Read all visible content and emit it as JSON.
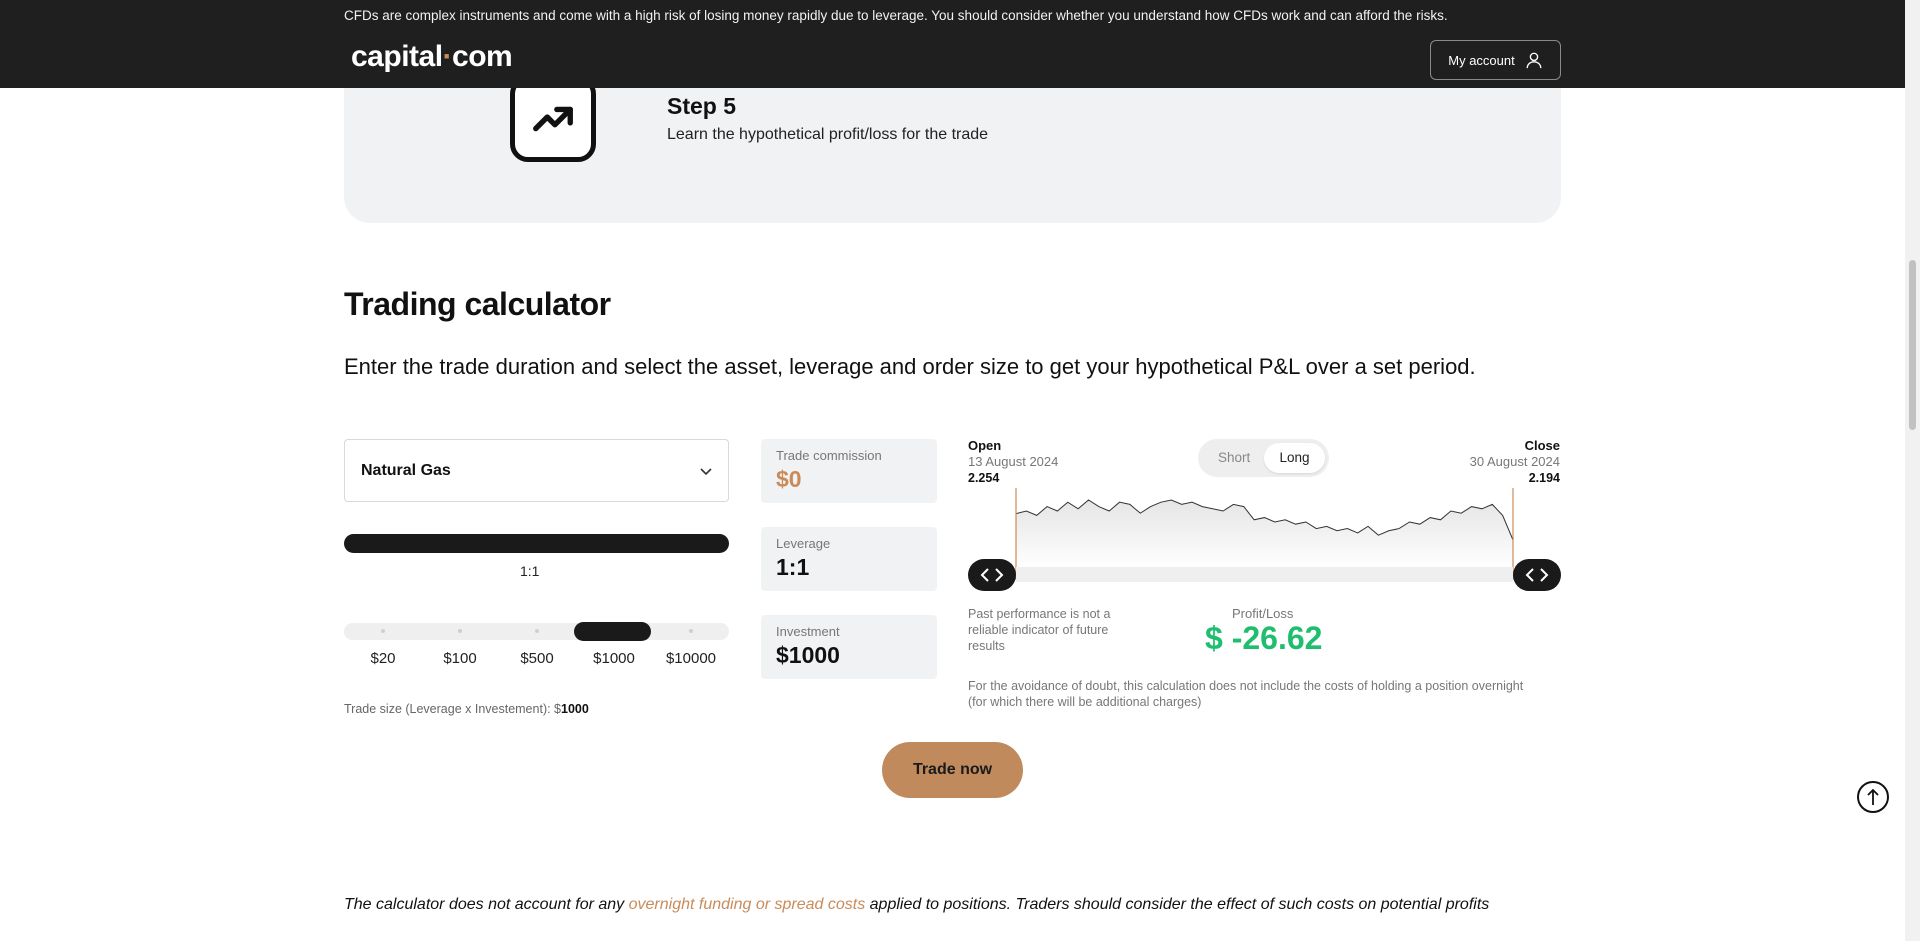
{
  "header": {
    "risk_warning": "CFDs are complex instruments and come with a high risk of losing money rapidly due to leverage. You should consider whether you understand how CFDs work and can afford the risks.",
    "logo_left": "capital",
    "logo_dot": "·",
    "logo_right": "com",
    "account_label": "My account"
  },
  "step": {
    "title": "Step 5",
    "description": "Learn the hypothetical profit/loss for the trade"
  },
  "calculator": {
    "title": "Trading calculator",
    "description": "Enter the trade duration and select the asset, leverage and order size to get your hypothetical P&L over a set period.",
    "asset": "Natural Gas",
    "leverage_label": "1:1",
    "investment_options": [
      "$20",
      "$100",
      "$500",
      "$1000",
      "$10000"
    ],
    "investment_selected_index": 3,
    "trade_size_prefix": "Trade size (Leverage x Investement): $",
    "trade_size_value": "1000",
    "boxes": {
      "commission_label": "Trade commission",
      "commission_value": "$0",
      "leverage_label": "Leverage",
      "leverage_value": "1:1",
      "investment_label": "Investment",
      "investment_value": "$1000"
    },
    "chart": {
      "open_label": "Open",
      "open_date": "13 August 2024",
      "open_price": "2.254",
      "close_label": "Close",
      "close_date": "30 August 2024",
      "close_price": "2.194",
      "short_label": "Short",
      "long_label": "Long",
      "selected_direction": "Long"
    },
    "past_performance": "Past performance is not a reliable indicator of future results",
    "profit_loss_label": "Profit/Loss",
    "profit_loss_value": "$ -26.62",
    "avoidance_note": "For the avoidance of doubt, this calculation does not include the costs of holding a position overnight (for which there will be additional charges)",
    "trade_button": "Trade now"
  },
  "chart_data": {
    "type": "line",
    "series": [
      {
        "values": [
          2.254,
          2.26,
          2.25,
          2.27,
          2.26,
          2.28,
          2.265,
          2.285,
          2.27,
          2.26,
          2.28,
          2.275,
          2.255,
          2.27,
          2.28,
          2.285,
          2.275,
          2.28,
          2.27,
          2.265,
          2.26,
          2.275,
          2.27,
          2.24,
          2.245,
          2.235,
          2.24,
          2.23,
          2.235,
          2.22,
          2.225,
          2.215,
          2.22,
          2.21,
          2.225,
          2.205,
          2.215,
          2.22,
          2.235,
          2.23,
          2.245,
          2.24,
          2.26,
          2.255,
          2.27,
          2.265,
          2.275,
          2.25,
          2.194
        ]
      }
    ],
    "x_range": [
      "13 August 2024",
      "30 August 2024"
    ],
    "colors": {
      "line": "#333333",
      "fill": "#e5e5e5",
      "marker": "#c98b5a"
    }
  },
  "footer": {
    "note_before": "The calculator does not account for any ",
    "note_link": "overnight funding or spread costs",
    "note_after": " applied to positions. Traders should consider the effect of such costs on potential profits"
  },
  "colors": {
    "accent": "#c98b5a",
    "profit_loss": "#1fbe6e",
    "dark": "#1f1f1f"
  }
}
